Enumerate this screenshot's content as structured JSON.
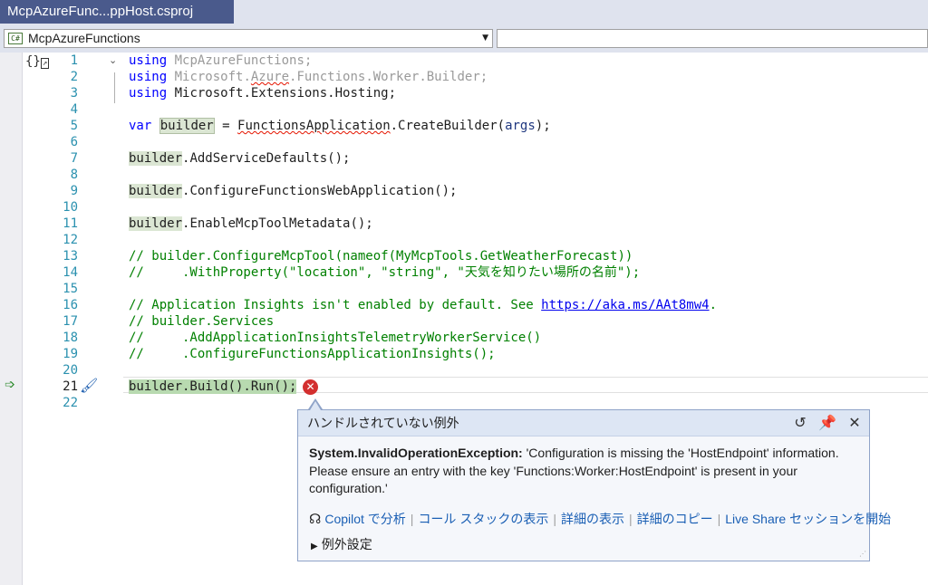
{
  "tab": {
    "title": "McpAzureFunc...ppHost.csproj"
  },
  "nav": {
    "project": "McpAzureFunctions",
    "project_icon_text": "C#",
    "right_value": ""
  },
  "code_lines": [
    {
      "n": "1"
    },
    {
      "n": "2"
    },
    {
      "n": "3"
    },
    {
      "n": "4"
    },
    {
      "n": "5"
    },
    {
      "n": "6"
    },
    {
      "n": "7"
    },
    {
      "n": "8"
    },
    {
      "n": "9"
    },
    {
      "n": "10"
    },
    {
      "n": "11"
    },
    {
      "n": "12"
    },
    {
      "n": "13"
    },
    {
      "n": "14"
    },
    {
      "n": "15"
    },
    {
      "n": "16"
    },
    {
      "n": "17"
    },
    {
      "n": "18"
    },
    {
      "n": "19"
    },
    {
      "n": "20"
    },
    {
      "n": "21"
    },
    {
      "n": "22"
    }
  ],
  "code": {
    "l1_kw": "using",
    "l1_rest": " McpAzureFunctions;",
    "l2_kw": "using",
    "l2_a": " Microsoft.",
    "l2_b": "Azure",
    "l2_c": ".Functions.Worker.Builder;",
    "l3_kw": "using",
    "l3_rest": " Microsoft.Extensions.Hosting;",
    "l5_kw": "var",
    "l5_var": "builder",
    "l5_eq": " = ",
    "l5_type": "FunctionsApplication",
    "l5_call": ".CreateBuilder(",
    "l5_arg": "args",
    "l5_end": ");",
    "l7_var": "builder",
    "l7_rest": ".AddServiceDefaults();",
    "l9_var": "builder",
    "l9_rest": ".ConfigureFunctionsWebApplication();",
    "l11_var": "builder",
    "l11_rest": ".EnableMcpToolMetadata();",
    "l13": "// builder.ConfigureMcpTool(nameof(MyMcpTools.GetWeatherForecast))",
    "l14": "//     .WithProperty(\"location\", \"string\", \"天気を知りたい場所の名前\");",
    "l16_a": "// Application Insights isn't enabled by default. See ",
    "l16_link": "https://aka.ms/AAt8mw4",
    "l16_b": ".",
    "l17": "// builder.Services",
    "l18": "//     .AddApplicationInsightsTelemetryWorkerService()",
    "l19": "//     .ConfigureFunctionsApplicationInsights();",
    "l21": "builder.Build().Run();"
  },
  "popup": {
    "title": "ハンドルされていない例外",
    "exception_type": "System.InvalidOperationException:",
    "message": " 'Configuration is missing the 'HostEndpoint' information. Please ensure an entry with the key 'Functions:Worker:HostEndpoint' is present in your configuration.'",
    "links": {
      "copilot": "Copilot で分析",
      "callstack": "コール スタックの表示",
      "details": "詳細の表示",
      "copy": "詳細のコピー",
      "liveshare": "Live Share セッションを開始"
    },
    "settings": "例外設定"
  },
  "colors": {
    "accent_tab": "#4a5a8c",
    "keyword": "#0000ff",
    "comment": "#008000",
    "line_number": "#2b91af",
    "error": "#d32f2f",
    "link": "#1a5fb4"
  }
}
